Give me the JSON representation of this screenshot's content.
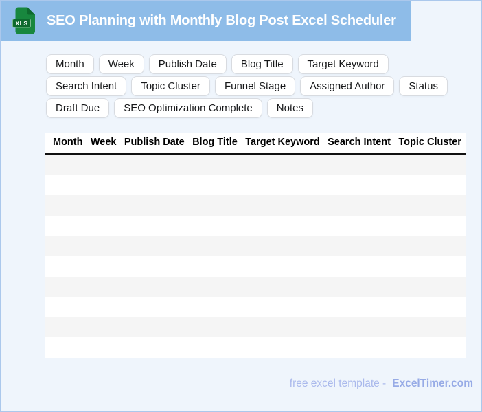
{
  "header": {
    "title": "SEO Planning with Monthly Blog Post Excel Scheduler",
    "icon_label": "XLS"
  },
  "chips": [
    "Month",
    "Week",
    "Publish Date",
    "Blog Title",
    "Target Keyword",
    "Search Intent",
    "Topic Cluster",
    "Funnel Stage",
    "Assigned Author",
    "Status",
    "Draft Due",
    "SEO Optimization Complete",
    "Notes"
  ],
  "table": {
    "columns": [
      "Month",
      "Week",
      "Publish Date",
      "Blog Title",
      "Target Keyword",
      "Search Intent",
      "Topic Cluster"
    ],
    "row_count": 10
  },
  "footer": {
    "text": "free excel template -",
    "brand": "ExcelTimer.com"
  },
  "colors": {
    "header_bg": "#8ebce8",
    "page_bg": "#eff5fc",
    "page_border": "#abc8ec",
    "chip_border": "#d8dbe0",
    "row_stripe": "#f5f5f5",
    "icon_green": "#18873e",
    "icon_green_dark": "#0e6a2e",
    "table_header_divider": "#111111",
    "footer_text": "#aab9ec",
    "footer_brand": "#97abe6"
  }
}
